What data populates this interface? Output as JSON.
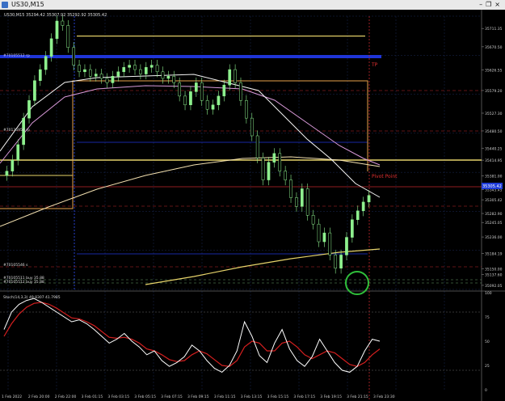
{
  "window": {
    "title": "US30,M15",
    "controls": [
      "–",
      "❐",
      "×"
    ]
  },
  "header": {
    "symbol_line": "US30,M15  35294.42 35307.92 35292.92 35305.42"
  },
  "annotations": {
    "label_top_blue": "#70105512 rp",
    "label_mid": "#70135958 rp",
    "label_bottom": "#70105546 s",
    "label_low1": "#70105511 buy 35.88",
    "label_low2": "#70105512 buy 35.88",
    "tp_label": "TP",
    "pivot_label": "Pivot Point",
    "stoch_label": "Stoch(14,3,3) 49.8307 41.7985",
    "current_price": "35305.42"
  },
  "price_axis": {
    "labels": [
      "35711.35",
      "35670.50",
      "35626.55",
      "35579.20",
      "35527.30",
      "35480.50",
      "35440.25",
      "35414.95",
      "35381.00",
      "35345.45",
      "35305.42",
      "35282.90",
      "35245.05",
      "35236.00",
      "35184.19",
      "35150.00",
      "35137.60",
      "35092.05"
    ],
    "label_rows": [
      0.045,
      0.112,
      0.197,
      0.272,
      0.355,
      0.42,
      0.483,
      0.527,
      0.585,
      0.635,
      0.672,
      0.722,
      0.755,
      0.808,
      0.868,
      0.925,
      0.945,
      0.985
    ]
  },
  "stoch_axis": {
    "labels": [
      "100",
      "75",
      "50",
      "25",
      "0"
    ]
  },
  "time_axis": {
    "labels": [
      "1 Feb 2022",
      "2 Feb 20:00",
      "2 Feb 22:00",
      "3 Feb 01:15",
      "3 Feb 03:15",
      "3 Feb 05:15",
      "3 Feb 07:15",
      "3 Feb 09:15",
      "3 Feb 11:15",
      "3 Feb 13:15",
      "3 Feb 15:15",
      "3 Feb 17:15",
      "3 Feb 19:15",
      "3 Feb 21:15",
      "3 Feb 23:30"
    ]
  },
  "colors": {
    "candle": "#8ef08e",
    "grid": "#1b2a55",
    "yellow": "#e6d36a",
    "orange": "#e8a24a",
    "blue": "#1f35d8",
    "red": "#c2272d",
    "white_ma": "#f5f5f5",
    "pink_ma": "#d99ad9",
    "green_circle": "#2fbf3a",
    "stoch_k": "#ffffff",
    "stoch_d": "#d41f1f"
  },
  "chart_data": {
    "type": "candlestick",
    "symbol": "US30",
    "timeframe": "M15",
    "ylim": [
      35092,
      35711
    ],
    "closes": [
      35360,
      35385,
      35420,
      35480,
      35520,
      35565,
      35590,
      35620,
      35660,
      35700,
      35690,
      35640,
      35600,
      35585,
      35590,
      35575,
      35580,
      35570,
      35560,
      35575,
      35585,
      35595,
      35600,
      35590,
      35580,
      35595,
      35600,
      35585,
      35570,
      35575,
      35560,
      35530,
      35510,
      35540,
      35560,
      35520,
      35500,
      35510,
      35530,
      35555,
      35590,
      35560,
      35520,
      35480,
      35440,
      35390,
      35340,
      35380,
      35400,
      35360,
      35340,
      35300,
      35280,
      35320,
      35260,
      35240,
      35200,
      35220,
      35170,
      35140,
      35170,
      35210,
      35250,
      35270,
      35290,
      35305
    ],
    "stochastic": {
      "k": [
        62,
        80,
        88,
        92,
        94,
        90,
        85,
        80,
        75,
        70,
        72,
        68,
        62,
        55,
        48,
        52,
        58,
        50,
        44,
        36,
        40,
        30,
        24,
        28,
        34,
        46,
        40,
        30,
        22,
        18,
        25,
        40,
        70,
        55,
        35,
        28,
        48,
        62,
        42,
        30,
        24,
        34,
        52,
        40,
        28,
        20,
        18,
        24,
        40,
        52,
        50
      ],
      "d": [
        55,
        68,
        78,
        85,
        89,
        90,
        88,
        84,
        79,
        74,
        73,
        70,
        66,
        60,
        54,
        53,
        54,
        52,
        48,
        42,
        40,
        36,
        31,
        29,
        30,
        36,
        40,
        37,
        31,
        25,
        24,
        30,
        44,
        50,
        48,
        40,
        40,
        48,
        50,
        44,
        36,
        32,
        36,
        40,
        38,
        32,
        26,
        24,
        28,
        36,
        42
      ]
    }
  }
}
